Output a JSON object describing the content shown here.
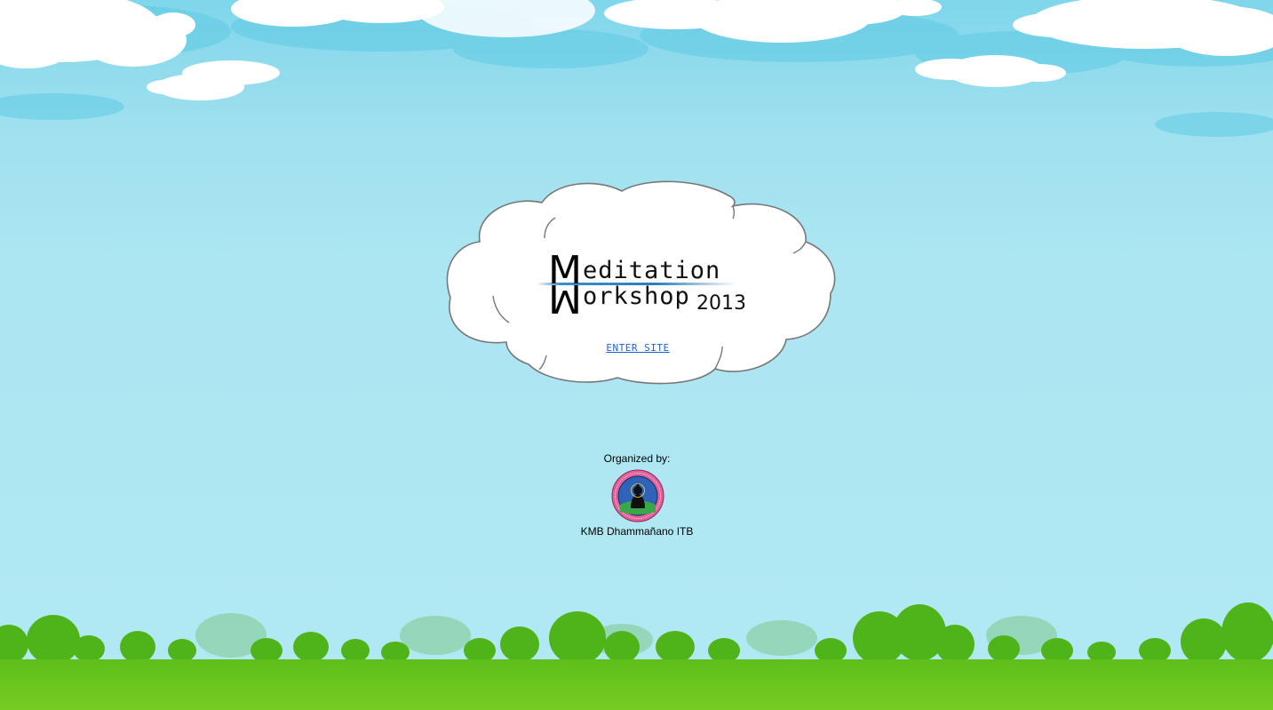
{
  "hero": {
    "title_line1_initial": "M",
    "title_line1_rest": "editation",
    "title_line2_initial": "W",
    "title_line2_rest": "orkshop",
    "year": "2013",
    "enter_label": "ENTER SITE"
  },
  "footer": {
    "organized_label": "Organized by:",
    "organizer_name": "KMB Dhammañano ITB",
    "emblem_icon": "organization-seal-icon"
  },
  "colors": {
    "sky_top": "#7fd6ea",
    "sky_bottom": "#b1e8f3",
    "grass": "#6fc620",
    "link": "#1d63d4"
  }
}
